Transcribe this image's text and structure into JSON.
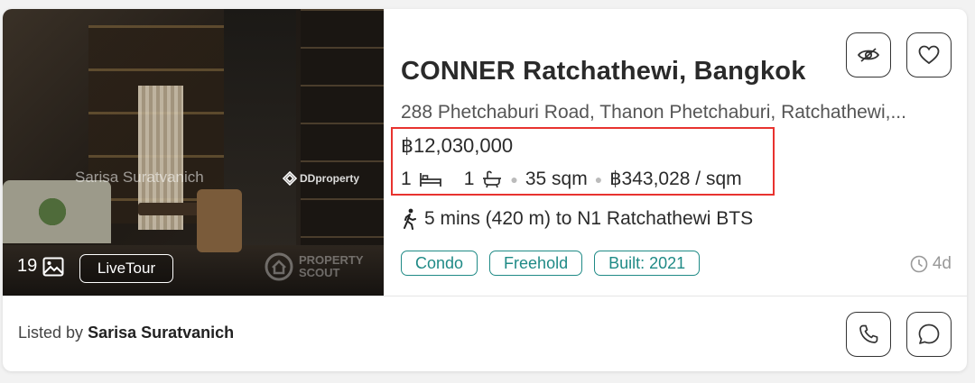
{
  "listing": {
    "photo_count": "19",
    "livetour_label": "LiveTour",
    "watermark_agent": "Sarisa Suratvanich",
    "watermark_brand": "DDproperty",
    "watermark_brand2_line1": "PROPERTY",
    "watermark_brand2_line2": "SCOUT",
    "title": "CONNER Ratchathewi, Bangkok",
    "address": "288 Phetchaburi Road, Thanon Phetchaburi, Ratchathewi,...",
    "price": "฿12,030,000",
    "bedrooms": "1",
    "bathrooms": "1",
    "area": "35 sqm",
    "price_per_sqm": "฿343,028 / sqm",
    "transit": "5 mins (420 m) to N1 Ratchathewi BTS",
    "tags": [
      "Condo",
      "Freehold",
      "Built: 2021"
    ],
    "age": "4d",
    "listed_by_prefix": "Listed by",
    "agent_name": "Sarisa Suratvanich"
  },
  "colors": {
    "tag": "#1f8a86",
    "highlight": "#e8332f"
  }
}
